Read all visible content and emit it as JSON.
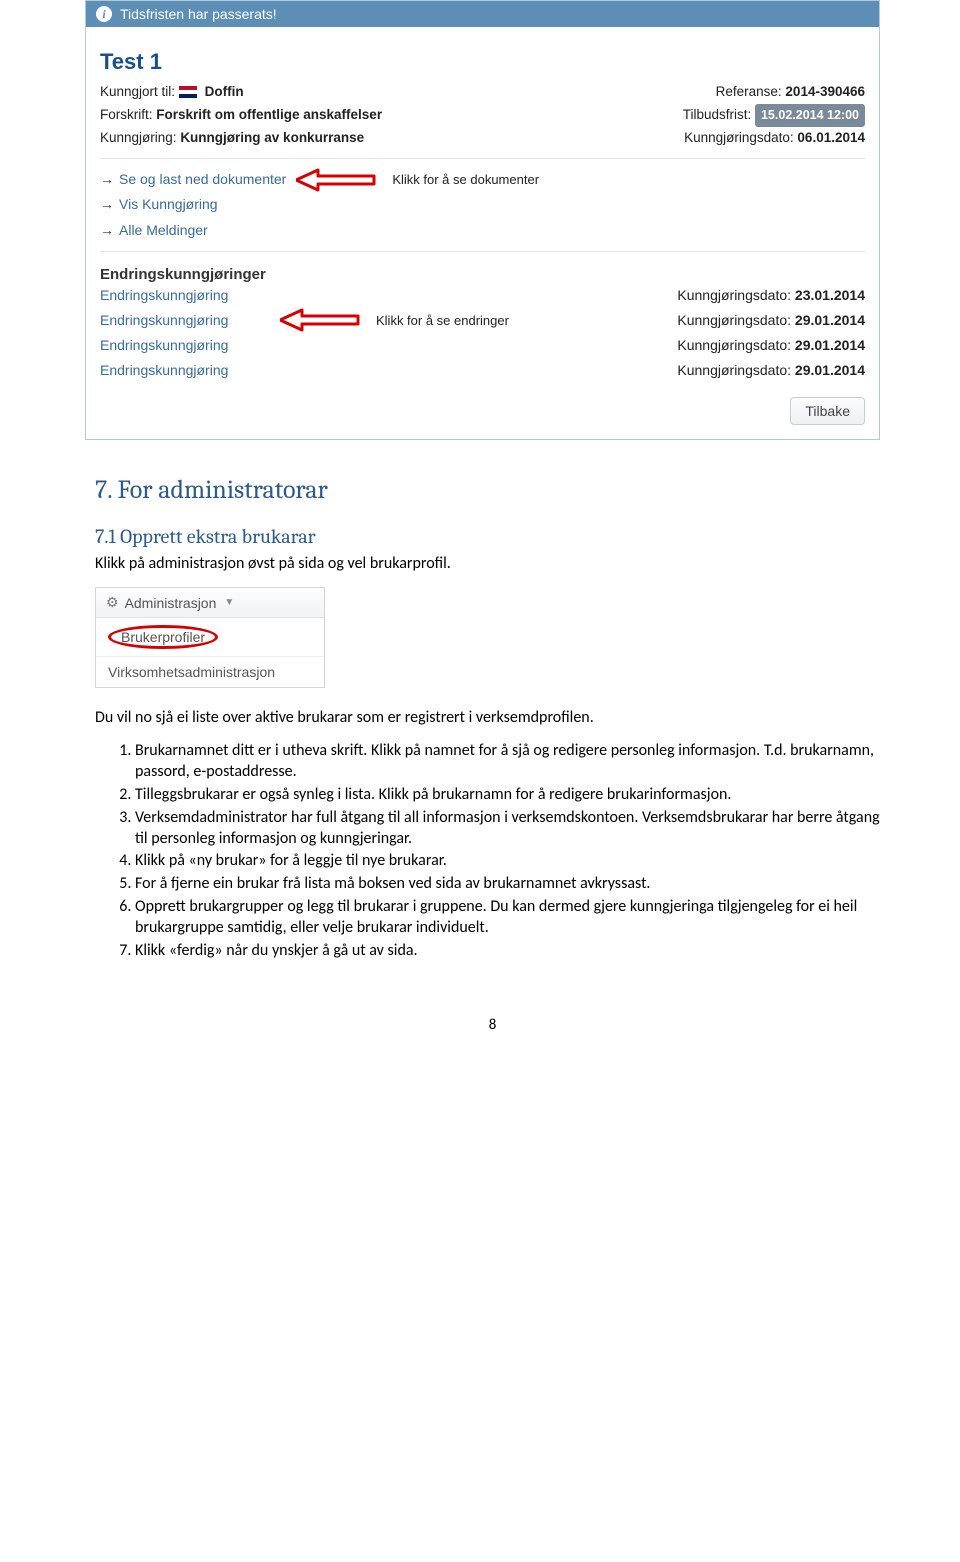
{
  "screenshot1": {
    "infoBar": "Tidsfristen har passerats!",
    "title": "Test 1",
    "left": {
      "pubTo_label": "Kunngjort til:",
      "pubTo_value": "Doffin",
      "forskrift_label": "Forskrift:",
      "forskrift_value": "Forskrift om offentlige anskaffelser",
      "kunngj_label": "Kunngjøring:",
      "kunngj_value": "Kunngjøring av konkurranse"
    },
    "right": {
      "ref_label": "Referanse:",
      "ref_value": "2014-390466",
      "frist_label": "Tilbudsfrist:",
      "frist_value": "15.02.2014 12:00",
      "pubdate_label": "Kunngjøringsdato:",
      "pubdate_value": "06.01.2014"
    },
    "actions": {
      "a1": "Se og last ned dokumenter",
      "a1_annot": "Klikk for å se dokumenter",
      "a2": "Vis Kunngjøring",
      "a3": "Alle Meldinger"
    },
    "ep_title": "Endringskunngjøringer",
    "ep_link": "Endringskunngjøring",
    "ep_date_label": "Kunngjøringsdato:",
    "ep_annot": "Klikk for å se endringer",
    "ep_dates": {
      "d1": "23.01.2014",
      "d2": "29.01.2014",
      "d3": "29.01.2014",
      "d4": "29.01.2014"
    },
    "back": "Tilbake"
  },
  "doc": {
    "h2": "7. For administratorar",
    "h3": "7.1 Opprett ekstra brukarar",
    "p1": "Klikk på administrasjon øvst på sida og vel brukarprofil.",
    "p2": "Du vil no sjå ei liste over aktive brukarar som er registrert i verksemdprofilen.",
    "li1": "Brukarnamnet ditt er i utheva skrift. Klikk på namnet for å sjå og redigere personleg informasjon. T.d. brukarnamn, passord, e-postaddresse.",
    "li2": "Tilleggsbrukarar er også synleg i lista. Klikk på brukarnamn for å redigere brukarinformasjon.",
    "li3": "Verksemdadministrator har full åtgang til all informasjon i verksemdskontoen. Verksemdsbrukarar har berre åtgang til personleg informasjon og kunngjeringar.",
    "li4": "Klikk på «ny brukar» for å leggje til nye brukarar.",
    "li5": "For å fjerne ein brukar frå lista må boksen ved sida av brukarnamnet avkryssast.",
    "li6": "Opprett brukargrupper og legg til brukarar i gruppene. Du kan dermed gjere kunngjeringa tilgjengeleg for ei heil brukargruppe samtidig, eller velje brukarar individuelt.",
    "li7": "Klikk «ferdig» når du ynskjer å gå ut av sida."
  },
  "mini": {
    "top": "Administrasjon",
    "item1": "Brukerprofiler",
    "item2": "Virksomhetsadministrasjon"
  },
  "pagenum": "8"
}
